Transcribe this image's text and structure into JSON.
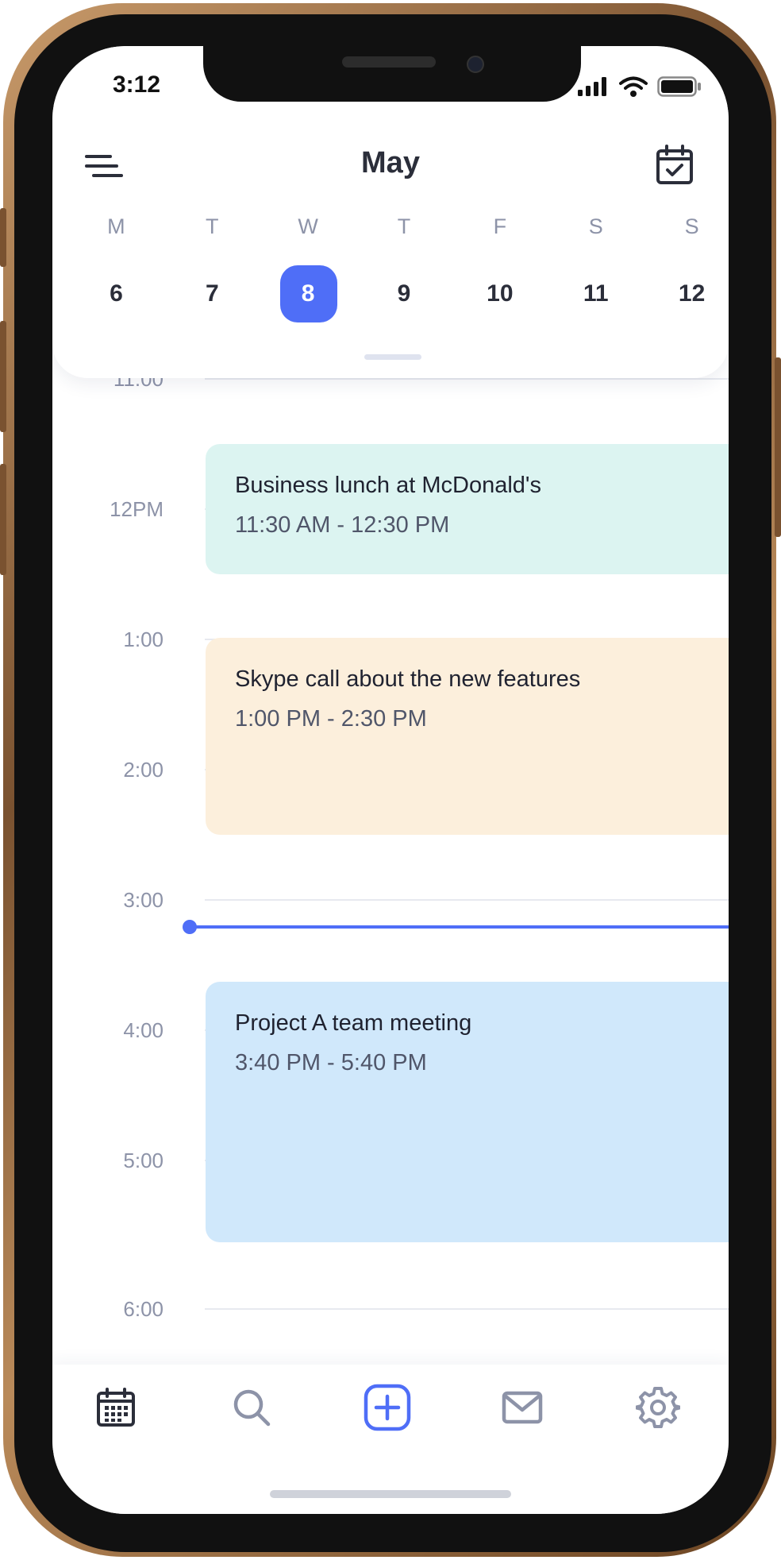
{
  "status_bar": {
    "time": "3:12"
  },
  "header": {
    "month": "May",
    "weekdays": [
      "M",
      "T",
      "W",
      "T",
      "F",
      "S",
      "S"
    ],
    "days": [
      "6",
      "7",
      "8",
      "9",
      "10",
      "11",
      "12"
    ],
    "selected_day": "8"
  },
  "timeline": {
    "hours": [
      "11:00",
      "12PM",
      "1:00",
      "2:00",
      "3:00",
      "4:00",
      "5:00",
      "6:00"
    ],
    "events": [
      {
        "title": "Business lunch at McDonald's",
        "time": "11:30 AM - 12:30 PM",
        "color": "#dcf4f1"
      },
      {
        "title": "Skype call about the new features",
        "time": "1:00 PM - 2:30 PM",
        "color": "#fcefdc"
      },
      {
        "title": "Project A team meeting",
        "time": "3:40 PM - 5:40 PM",
        "color": "#d0e8fb"
      }
    ],
    "current_time_color": "#4f6ef7"
  },
  "tab_bar": {
    "items": [
      "calendar-icon",
      "search-icon",
      "add-icon",
      "mail-icon",
      "settings-icon"
    ],
    "active_color": "#2b2e3a",
    "accent_color": "#4f6ef7"
  }
}
